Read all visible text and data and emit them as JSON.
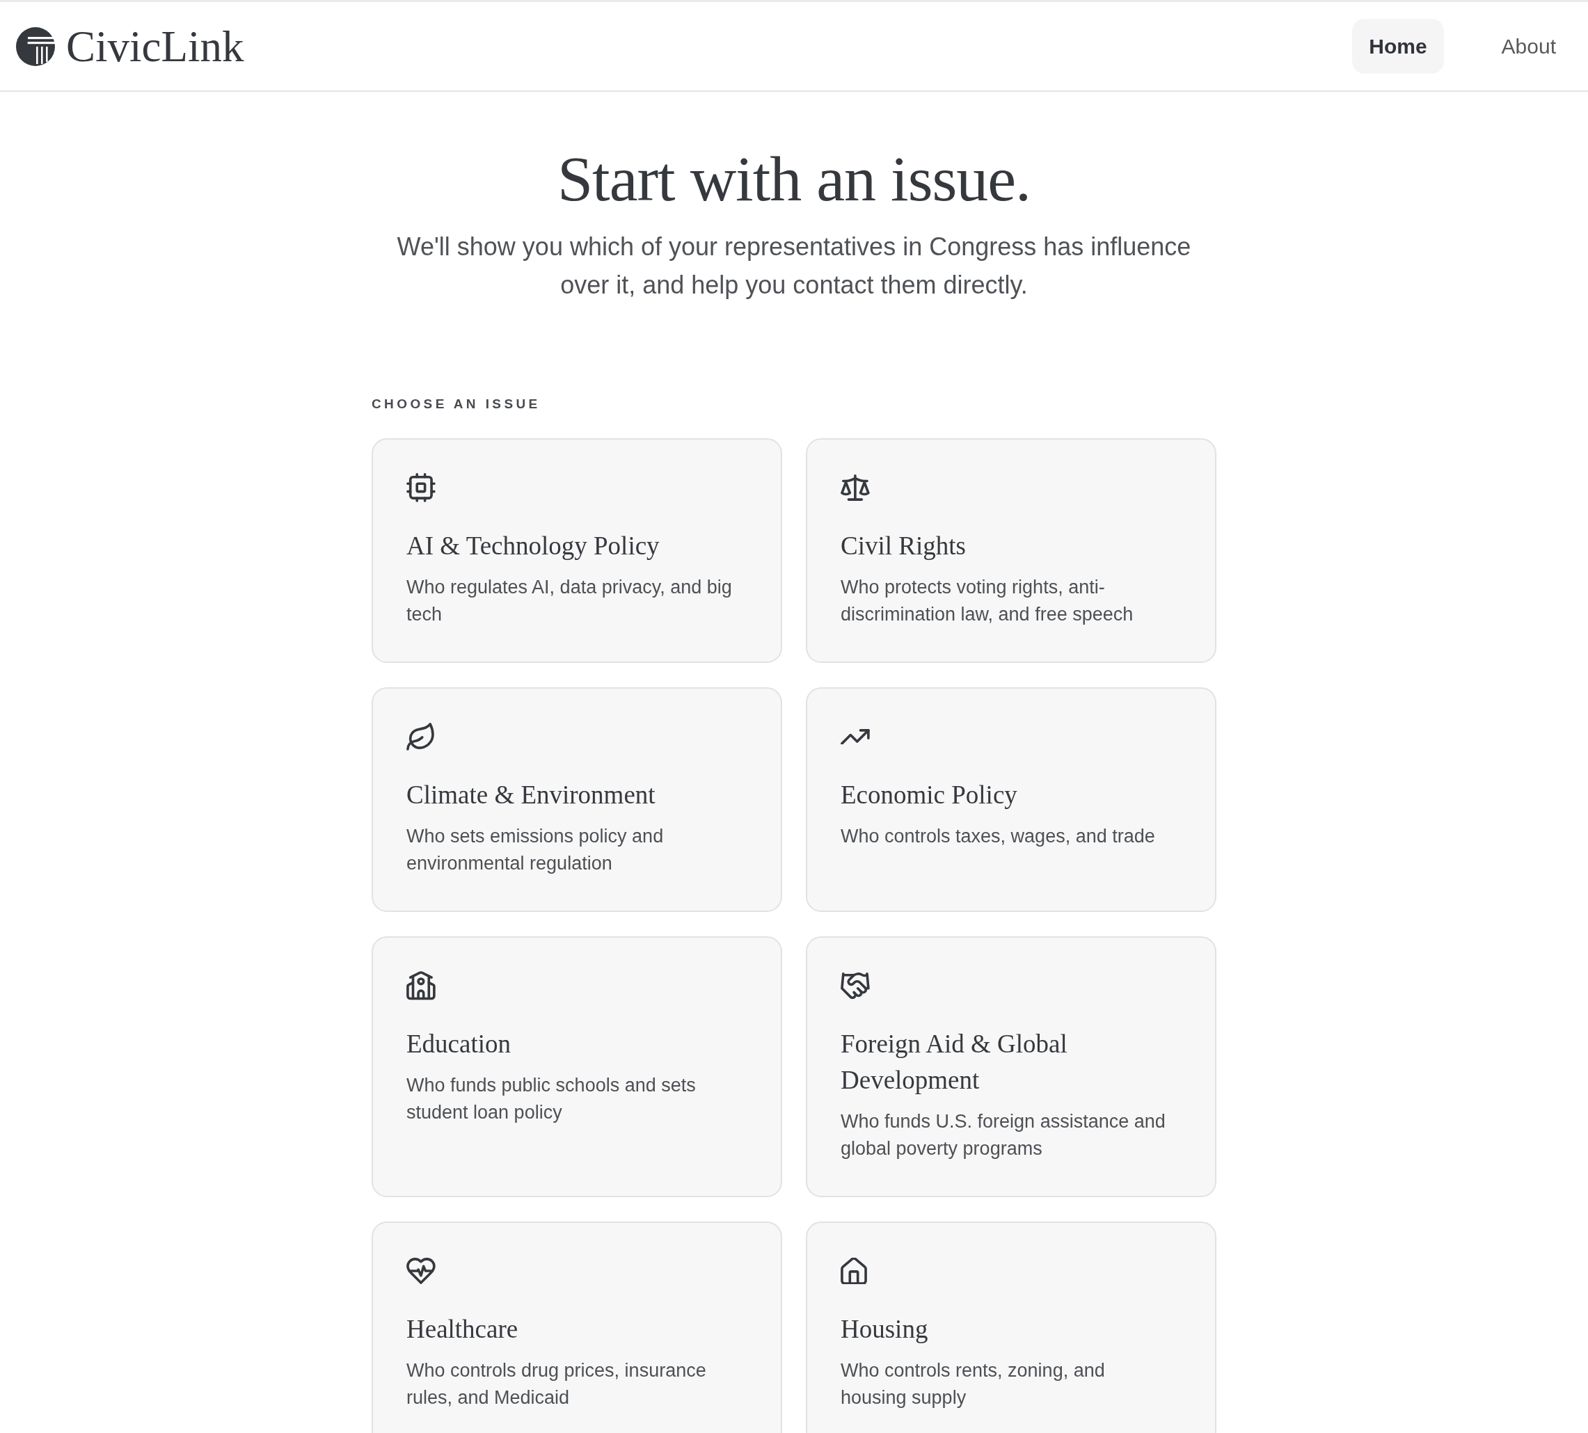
{
  "header": {
    "brand": "CivicLink",
    "nav": [
      {
        "label": "Home",
        "selected": true
      },
      {
        "label": "About",
        "selected": false
      }
    ]
  },
  "hero": {
    "title": "Start with an issue.",
    "subtitle": "We'll show you which of your representatives in Congress has influence over it, and help you contact them directly."
  },
  "issues": {
    "heading": "CHOOSE AN ISSUE",
    "cards": [
      {
        "title": "AI & Technology Policy",
        "description": "Who regulates AI, data privacy, and big tech"
      },
      {
        "title": "Civil Rights",
        "description": "Who protects voting rights, anti-discrimination law, and free speech"
      },
      {
        "title": "Climate & Environment",
        "description": "Who sets emissions policy and environmental regulation"
      },
      {
        "title": "Economic Policy",
        "description": "Who controls taxes, wages, and trade"
      },
      {
        "title": "Education",
        "description": "Who funds public schools and sets student loan policy"
      },
      {
        "title": "Foreign Aid & Global Development",
        "description": "Who funds U.S. foreign assistance and global poverty programs"
      },
      {
        "title": "Healthcare",
        "description": "Who controls drug prices, insurance rules, and Medicaid"
      },
      {
        "title": "Housing",
        "description": "Who controls rents, zoning, and housing supply"
      }
    ]
  }
}
